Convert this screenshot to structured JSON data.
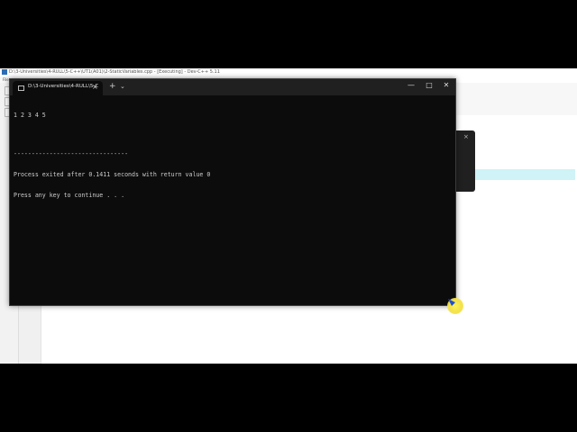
{
  "ide": {
    "title": "D:\\3-Universities\\4-RULL\\5-C++\\UT1(A01)\\2-StaticVariables.cpp - [Executing] - Dev-C++ 5.11",
    "menu_label": "File"
  },
  "terminal": {
    "tab_title": "D:\\3-Universities\\4-RULL\\5-C",
    "new_tab": "+",
    "dropdown": "⌄",
    "tab_close": "×",
    "minimize": "—",
    "maximize": "□",
    "close": "✕",
    "lines": [
      "1 2 3 4 5",
      "--------------------------------",
      "Process exited after 0.1411 seconds with return value 0",
      "Press any key to continue . . ."
    ]
  },
  "bg_window": {
    "close": "×"
  }
}
